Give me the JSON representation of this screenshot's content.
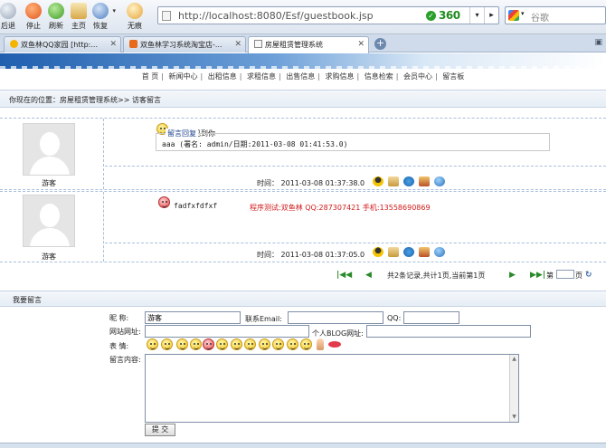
{
  "browser": {
    "buttons": [
      {
        "label": "后退",
        "icon": "back-icon"
      },
      {
        "label": "停止",
        "icon": "stop-icon"
      },
      {
        "label": "刷新",
        "icon": "refresh-icon"
      },
      {
        "label": "主页",
        "icon": "home-icon"
      },
      {
        "label": "恢复",
        "icon": "restore-icon"
      },
      {
        "label": "无痕",
        "icon": "incognito-icon"
      }
    ],
    "url": "http://localhost:8080/Esf/guestbook.jsp",
    "brand": "360",
    "search_placeholder": "谷歌",
    "tabs": [
      {
        "label": "双鱼林QQ家园 [http:..."
      },
      {
        "label": "双鱼林学习系统淘宝店-..."
      },
      {
        "label": "房屋租赁管理系统"
      }
    ]
  },
  "nav": {
    "items": [
      "首 页",
      "新闻中心",
      "出租信息",
      "求租信息",
      "出售信息",
      "求购信息",
      "信息检索",
      "会员中心",
      "留言板"
    ]
  },
  "breadcrumb": "你现在的位置：房屋租赁管理系统>> 访客留言",
  "messages": [
    {
      "guest": "游客",
      "content": "很高兴见到你",
      "reply_label": "留言回复",
      "reply_text": "aaa (署名: admin/日期:2011-03-08 01:41:53.0)",
      "time": "时间： 2011-03-08 01:37:38.0"
    },
    {
      "guest": "游客",
      "content": "fadfxfdfxf",
      "ad": "程序测试:双鱼林 QQ:287307421 手机:13558690869",
      "time": "时间： 2011-03-08 01:37:05.0"
    }
  ],
  "pager": {
    "info": "共2条记录,共计1页,当前第1页",
    "goto_prefix": "第",
    "goto_suffix": "页"
  },
  "form": {
    "title": "我要留言",
    "nickname_label": "昵    称:",
    "nickname_value": "游客",
    "email_label": "联系Email:",
    "qq_label": "QQ:",
    "website_label": "网站网址:",
    "blog_label": "个人BLOG网址:",
    "emotion_label": "表    情:",
    "content_label": "留言内容:",
    "submit_label": "提 交"
  },
  "colors": {
    "accent": "#1f5fae",
    "ad_red": "#d11a1a",
    "pager_green": "#2b8a2b"
  }
}
